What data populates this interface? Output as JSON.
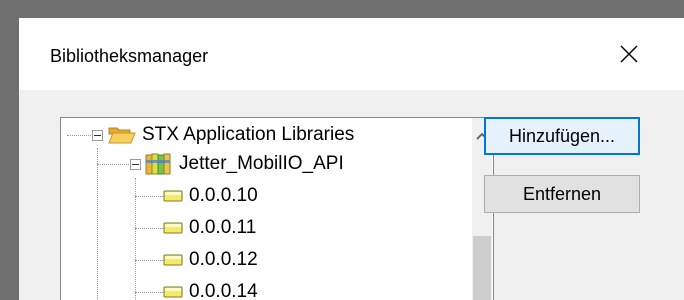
{
  "dialog": {
    "title": "Bibliotheksmanager",
    "close_icon": "close-icon"
  },
  "tree": {
    "root": {
      "label": "STX Application Libraries",
      "icon": "open-folder-icon",
      "expanded": true
    },
    "library": {
      "label": "Jetter_MobilIO_API",
      "icon": "library-books-icon",
      "expanded": true
    },
    "versions": [
      {
        "label": "0.0.0.10",
        "icon": "version-icon"
      },
      {
        "label": "0.0.0.11",
        "icon": "version-icon"
      },
      {
        "label": "0.0.0.12",
        "icon": "version-icon"
      },
      {
        "label": "0.0.0.14",
        "icon": "version-icon"
      }
    ]
  },
  "buttons": {
    "add_label": "Hinzufügen...",
    "remove_label": "Entfernen"
  },
  "colors": {
    "accent": "#0078d7",
    "folder": "#f2c04a",
    "version_chip": "#f5ea6a"
  }
}
